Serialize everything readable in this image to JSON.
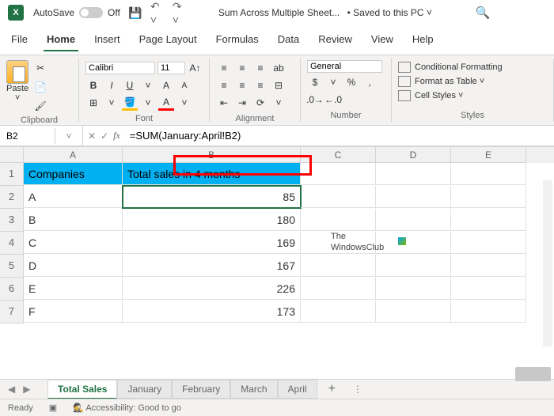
{
  "titlebar": {
    "autosave": "AutoSave",
    "autosave_state": "Off",
    "title": "Sum Across Multiple Sheet...",
    "saved": "• Saved to this PC ˅"
  },
  "menu": {
    "file": "File",
    "home": "Home",
    "insert": "Insert",
    "page_layout": "Page Layout",
    "formulas": "Formulas",
    "data": "Data",
    "review": "Review",
    "view": "View",
    "help": "Help"
  },
  "ribbon": {
    "clipboard": {
      "paste": "Paste",
      "label": "Clipboard"
    },
    "font": {
      "name": "Calibri",
      "size": "11",
      "label": "Font"
    },
    "alignment": {
      "label": "Alignment"
    },
    "number": {
      "format": "General",
      "label": "Number"
    },
    "styles": {
      "cond": "Conditional Formatting",
      "table": "Format as Table ˅",
      "cell": "Cell Styles ˅",
      "label": "Styles"
    }
  },
  "formula_bar": {
    "cell_ref": "B2",
    "formula": "=SUM(January:April!B2)"
  },
  "columns": [
    "A",
    "B",
    "C",
    "D",
    "E"
  ],
  "rows": [
    {
      "n": "1",
      "a": "Companies",
      "b": "Total sales in 4 months"
    },
    {
      "n": "2",
      "a": "A",
      "b": "85"
    },
    {
      "n": "3",
      "a": "B",
      "b": "180"
    },
    {
      "n": "4",
      "a": "C",
      "b": "169"
    },
    {
      "n": "5",
      "a": "D",
      "b": "167"
    },
    {
      "n": "6",
      "a": "E",
      "b": "226"
    },
    {
      "n": "7",
      "a": "F",
      "b": "173"
    }
  ],
  "watermark": {
    "line1": "The",
    "line2": "WindowsClub"
  },
  "tabs": {
    "active": "Total Sales",
    "t1": "January",
    "t2": "February",
    "t3": "March",
    "t4": "April"
  },
  "status": {
    "ready": "Ready",
    "accessibility": "Accessibility: Good to go"
  }
}
